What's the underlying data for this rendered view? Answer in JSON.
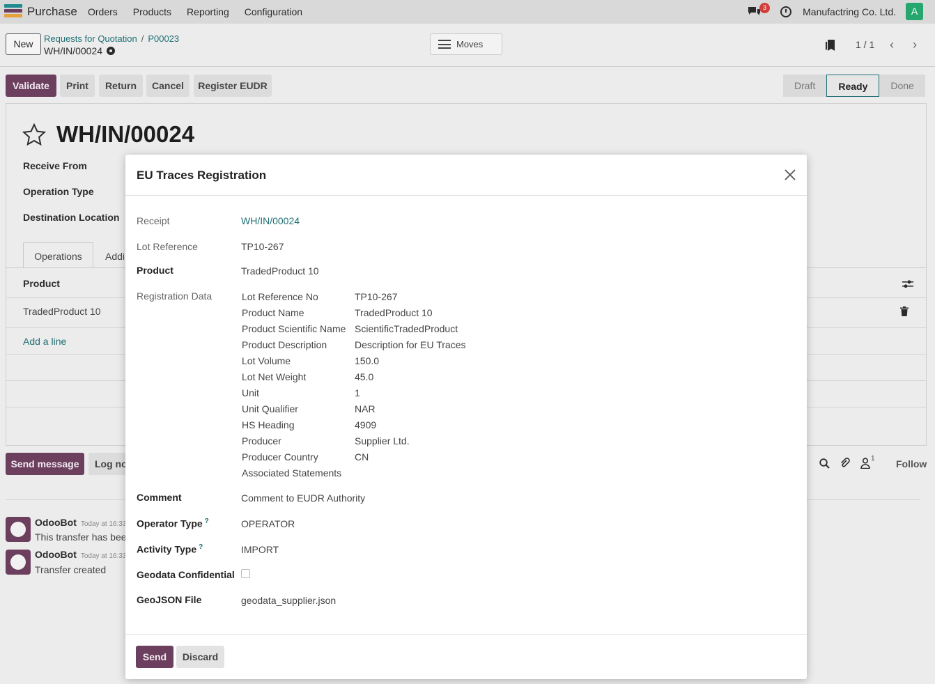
{
  "navbar": {
    "app_name": "Purchase",
    "menu": [
      "Orders",
      "Products",
      "Reporting",
      "Configuration"
    ],
    "chat_count": "3",
    "company": "Manufactring Co. Ltd.",
    "user_initial": "A",
    "colors": {
      "accent": "#6b3f5d",
      "link": "#1f6f73",
      "avatar": "#26a76f",
      "badge": "#d23f3a"
    }
  },
  "control": {
    "new_label": "New",
    "breadcrumb": [
      "Requests for Quotation",
      "P00023"
    ],
    "record": "WH/IN/00024",
    "moves_label": "Moves",
    "pager": "1 / 1"
  },
  "actions": {
    "buttons": [
      "Validate",
      "Print",
      "Return",
      "Cancel",
      "Register EUDR"
    ],
    "stages": [
      "Draft",
      "Ready",
      "Done"
    ],
    "active_stage": "Ready"
  },
  "form": {
    "title": "WH/IN/00024",
    "labels": [
      "Receive From",
      "Operation Type",
      "Destination Location"
    ],
    "tabs": [
      "Operations",
      "Addi"
    ],
    "column_product": "Product",
    "rows": [
      "TradedProduct 10"
    ],
    "add_line": "Add a line"
  },
  "chatter": {
    "send_message": "Send message",
    "log_note": "Log note",
    "follow": "Follow",
    "follower_count": "1",
    "messages": [
      {
        "author": "OdooBot",
        "time": "Today at 16:33",
        "body": "This transfer has been"
      },
      {
        "author": "OdooBot",
        "time": "Today at 16:33",
        "body": "Transfer created"
      }
    ]
  },
  "dialog": {
    "title": "EU Traces Registration",
    "receipt_label": "Receipt",
    "receipt_value": "WH/IN/00024",
    "lot_ref_label": "Lot Reference",
    "lot_ref_value": "TP10-267",
    "product_label": "Product",
    "product_value": "TradedProduct 10",
    "reg_label": "Registration Data",
    "registration": [
      [
        "Lot Reference No",
        "TP10-267"
      ],
      [
        "Product Name",
        "TradedProduct 10"
      ],
      [
        "Product Scientific Name",
        "ScientificTradedProduct"
      ],
      [
        "Product Description",
        "Description for EU Traces"
      ],
      [
        "Lot Volume",
        "150.0"
      ],
      [
        "Lot Net Weight",
        "45.0"
      ],
      [
        "Unit",
        "1"
      ],
      [
        "Unit Qualifier",
        "NAR"
      ],
      [
        "HS Heading",
        "4909"
      ],
      [
        "Producer",
        "Supplier Ltd."
      ],
      [
        "Producer Country",
        "CN"
      ],
      [
        "Associated Statements",
        ""
      ]
    ],
    "comment_label": "Comment",
    "comment_value": "Comment to EUDR Authority",
    "operator_label": "Operator Type",
    "operator_value": "OPERATOR",
    "activity_label": "Activity Type",
    "activity_value": "IMPORT",
    "help_mark": "?",
    "geodata_label": "Geodata Confidential",
    "geodata_checked": false,
    "geojson_label": "GeoJSON File",
    "geojson_value": "geodata_supplier.json",
    "send_label": "Send",
    "discard_label": "Discard"
  }
}
